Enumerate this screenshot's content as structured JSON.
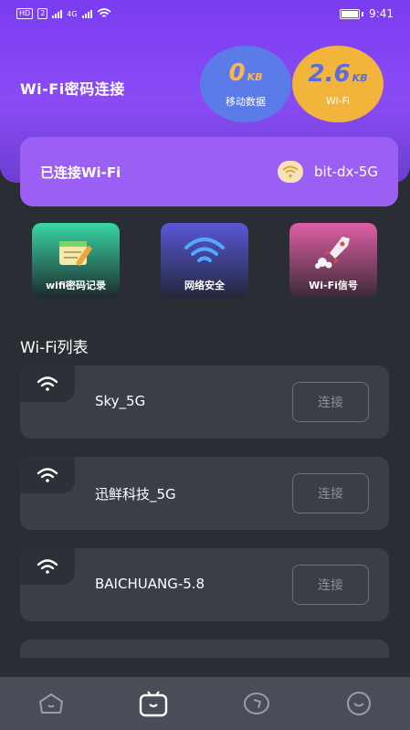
{
  "status_bar": {
    "tags": [
      "HD",
      "2",
      "4G"
    ],
    "time": "9:41"
  },
  "header": {
    "title": "Wi-Fi密码连接",
    "mobile_data": {
      "value": "0",
      "unit": "KB",
      "label": "移动数据"
    },
    "wifi_data": {
      "value": "2.6",
      "unit": "KB",
      "label": "Wi-Fi"
    }
  },
  "connected": {
    "label": "已连接Wi-Fi",
    "ssid": "bit-dx-5G"
  },
  "features": [
    {
      "label": "wifi密码记录",
      "icon": "notepad-pencil-icon"
    },
    {
      "label": "网络安全",
      "icon": "wifi-signal-icon"
    },
    {
      "label": "Wi-Fi信号",
      "icon": "rocket-icon"
    }
  ],
  "list": {
    "title": "Wi-Fi列表",
    "items": [
      {
        "ssid": "Sky_5G",
        "button": "连接"
      },
      {
        "ssid": "迅鲜科技_5G",
        "button": "连接"
      },
      {
        "ssid": "BAICHUANG-5.8",
        "button": "连接"
      }
    ]
  },
  "nav": [
    "home-icon",
    "tv-icon",
    "explore-icon",
    "smile-icon"
  ],
  "colors": {
    "header_purple": "#7a3cf0",
    "card_purple": "#9b5ff3",
    "bubble_blue": "#5a7be8",
    "bubble_yellow": "#f3b43b",
    "background": "#2b2d35"
  }
}
